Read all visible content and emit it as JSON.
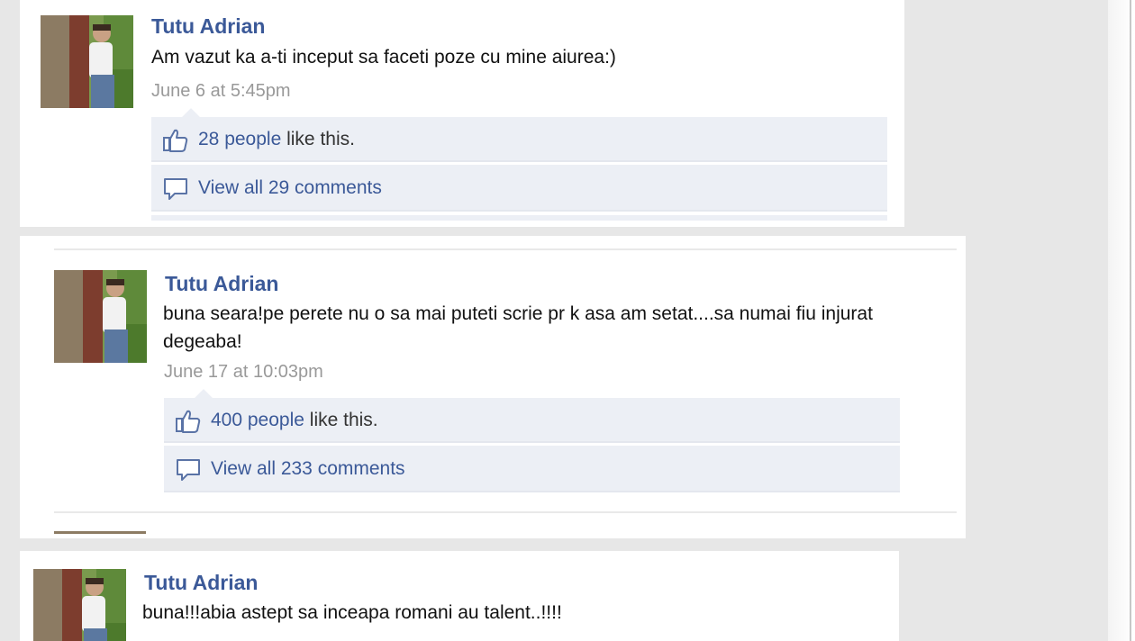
{
  "colors": {
    "link": "#3b5998",
    "timestamp": "#999999",
    "ufi_background": "#eceff5",
    "page_background": "#e7e7e7"
  },
  "posts": [
    {
      "author": "Tutu Adrian",
      "message": "Am vazut ka a-ti inceput sa faceti poze cu mine aiurea:)",
      "timestamp": "June 6 at 5:45pm",
      "likes_link": "28 people",
      "likes_suffix": " like this.",
      "comments_link": "View all 29 comments",
      "like_icon": "thumbs-up-icon",
      "comment_icon": "comment-bubble-icon"
    },
    {
      "author": "Tutu Adrian",
      "message": "buna seara!pe perete nu o sa mai puteti scrie pr k asa am setat....sa numai fiu injurat degeaba!",
      "timestamp": "June 17 at 10:03pm",
      "likes_link": "400 people",
      "likes_suffix": " like this.",
      "comments_link": "View all 233 comments",
      "like_icon": "thumbs-up-icon",
      "comment_icon": "comment-bubble-icon"
    },
    {
      "author": "Tutu Adrian",
      "message": "buna!!!abia astept sa inceapa romani au talent..!!!!"
    }
  ]
}
